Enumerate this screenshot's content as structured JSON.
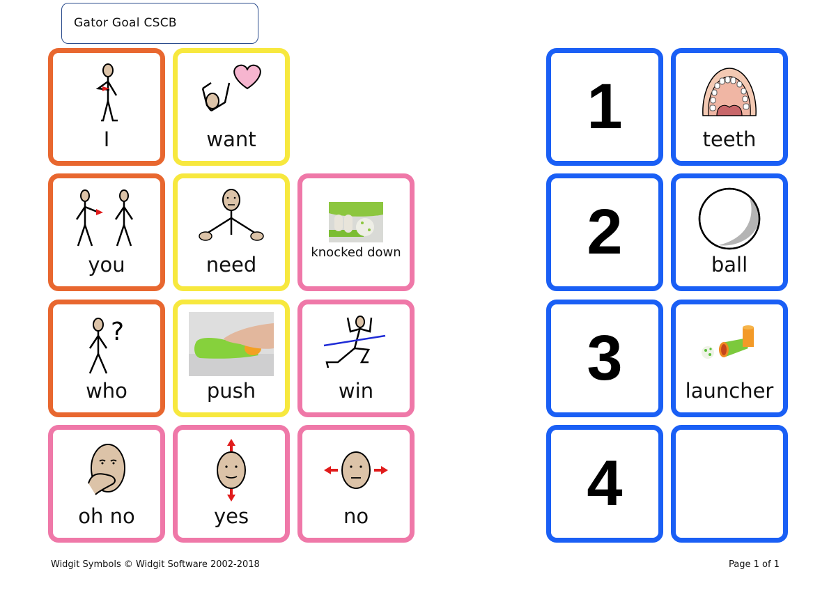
{
  "title": "Gator Goal CSCB",
  "left_grid": [
    {
      "label": "I",
      "color": "orange",
      "icon": "person-pointing-self-icon"
    },
    {
      "label": "want",
      "color": "yellow",
      "icon": "person-reaching-heart-icon"
    },
    {
      "label": "you",
      "color": "orange",
      "icon": "person-pointing-other-icon"
    },
    {
      "label": "need",
      "color": "yellow",
      "icon": "person-open-hands-icon"
    },
    {
      "label": "knocked down",
      "color": "pink",
      "icon": "knocked-down-photo"
    },
    {
      "label": "who",
      "color": "orange",
      "icon": "person-question-icon"
    },
    {
      "label": "push",
      "color": "yellow",
      "icon": "push-photo"
    },
    {
      "label": "win",
      "color": "pink",
      "icon": "person-finish-line-icon"
    },
    {
      "label": "oh no",
      "color": "pink",
      "icon": "face-hand-mouth-icon"
    },
    {
      "label": "yes",
      "color": "pink",
      "icon": "face-nod-icon"
    },
    {
      "label": "no",
      "color": "pink",
      "icon": "face-shake-icon"
    }
  ],
  "right_grid": [
    {
      "number": "1",
      "label": "teeth",
      "icon": "teeth-icon"
    },
    {
      "number": "2",
      "label": "ball",
      "icon": "ball-icon"
    },
    {
      "number": "3",
      "label": "launcher",
      "icon": "launcher-photo"
    },
    {
      "number": "4",
      "label": "",
      "icon": ""
    }
  ],
  "footer": {
    "copyright": "Widgit Symbols © Widgit Software 2002-2018",
    "page": "Page 1 of 1"
  }
}
